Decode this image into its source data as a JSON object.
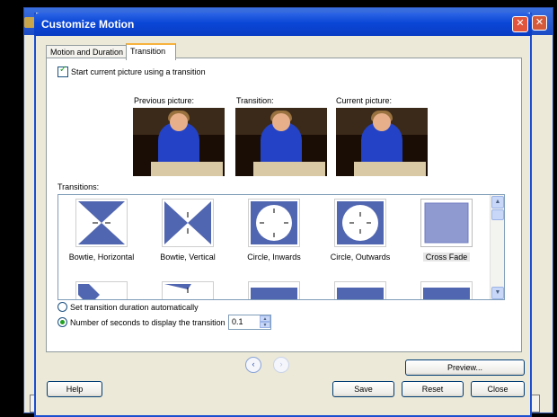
{
  "background_window": {
    "close_glyph": "✕"
  },
  "dialog": {
    "title": "Customize Motion",
    "close_glyph": "✕",
    "tabs": [
      {
        "label": "Motion and Duration",
        "active": false
      },
      {
        "label": "Transition",
        "active": true
      }
    ],
    "start_transition_checkbox": {
      "label": "Start current picture using a transition",
      "checked": true
    },
    "pictures": {
      "previous_label": "Previous picture:",
      "transition_label": "Transition:",
      "current_label": "Current picture:"
    },
    "transitions_label": "Transitions:",
    "transitions": [
      {
        "label": "Bowtie, Horizontal",
        "icon": "bowtie-horizontal-icon",
        "selected": false
      },
      {
        "label": "Bowtie, Vertical",
        "icon": "bowtie-vertical-icon",
        "selected": false
      },
      {
        "label": "Circle, Inwards",
        "icon": "circle-inwards-icon",
        "selected": false
      },
      {
        "label": "Circle, Outwards",
        "icon": "circle-outwards-icon",
        "selected": false
      },
      {
        "label": "Cross Fade",
        "icon": "cross-fade-icon",
        "selected": true
      }
    ],
    "scroll_up_glyph": "▲",
    "scroll_down_glyph": "▼",
    "duration": {
      "auto_label": "Set transition duration automatically",
      "seconds_label": "Number of seconds to display the transition",
      "seconds_value": "0.1",
      "selected_option": "seconds",
      "spin_up_glyph": "▲",
      "spin_down_glyph": "▼"
    },
    "nav": {
      "previous_glyph": "‹",
      "next_glyph": "›",
      "next_disabled": true
    },
    "buttons": {
      "preview": "Preview...",
      "help": "Help",
      "save": "Save",
      "reset": "Reset",
      "close": "Close"
    },
    "colors": {
      "title_bar": "#0a46d6",
      "transition_fill": "#5166b0",
      "checkmark": "#21a121"
    }
  }
}
